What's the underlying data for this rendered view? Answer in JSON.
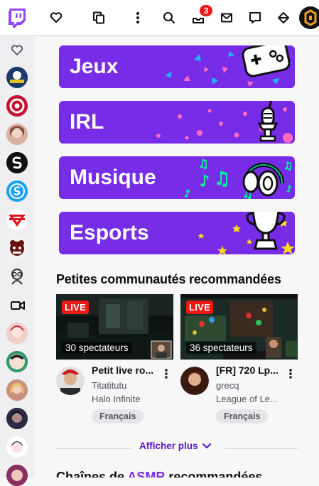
{
  "topbar": {
    "notification_count": "3",
    "icons": [
      "twitch-logo-icon",
      "following-heart-icon",
      "browse-icon",
      "more-vertical-icon",
      "search-icon",
      "notifications-inbox-icon",
      "whispers-mail-icon",
      "chat-bubble-icon",
      "prime-crown-icon",
      "user-avatar"
    ]
  },
  "sidebar": {
    "header_icon": "followed-heart-icon",
    "camera_icon": "video-camera-icon",
    "avatar_colors": [
      "#1b3a6b",
      "#c8102e",
      "#c99a8a",
      "#111111",
      "#1da1f2",
      "#d71920",
      "#6b1010",
      "#ffffff",
      "#e8c0b8",
      "#2a6a4a",
      "#c8907a",
      "#303050",
      "#f0d0d8",
      "#8a3060"
    ]
  },
  "categories": [
    {
      "label": "Jeux",
      "icon": "gamepad-icon"
    },
    {
      "label": "IRL",
      "icon": "microphone-icon"
    },
    {
      "label": "Musique",
      "icon": "headphones-icon"
    },
    {
      "label": "Esports",
      "icon": "trophy-icon"
    }
  ],
  "recommended": {
    "title": "Petites communautés recommandées",
    "streams": [
      {
        "live": "LIVE",
        "viewers": "30 spectateurs",
        "title": "Petit live ro...",
        "channel": "Titatitutu",
        "game": "Halo Infinite",
        "tag": "Français"
      },
      {
        "live": "LIVE",
        "viewers": "36 spectateurs",
        "title": "[FR] 720 Lp...",
        "channel": "grecq",
        "game": "League of Le...",
        "tag": "Français"
      }
    ],
    "show_more": "Afficher plus"
  },
  "next_section": {
    "title_prefix": "Chaînes de ",
    "title_accent": "ASMR",
    "title_suffix": " recommandées"
  },
  "colors": {
    "brand": "#772ce8",
    "live": "#e91916",
    "link": "#5c16c5"
  }
}
